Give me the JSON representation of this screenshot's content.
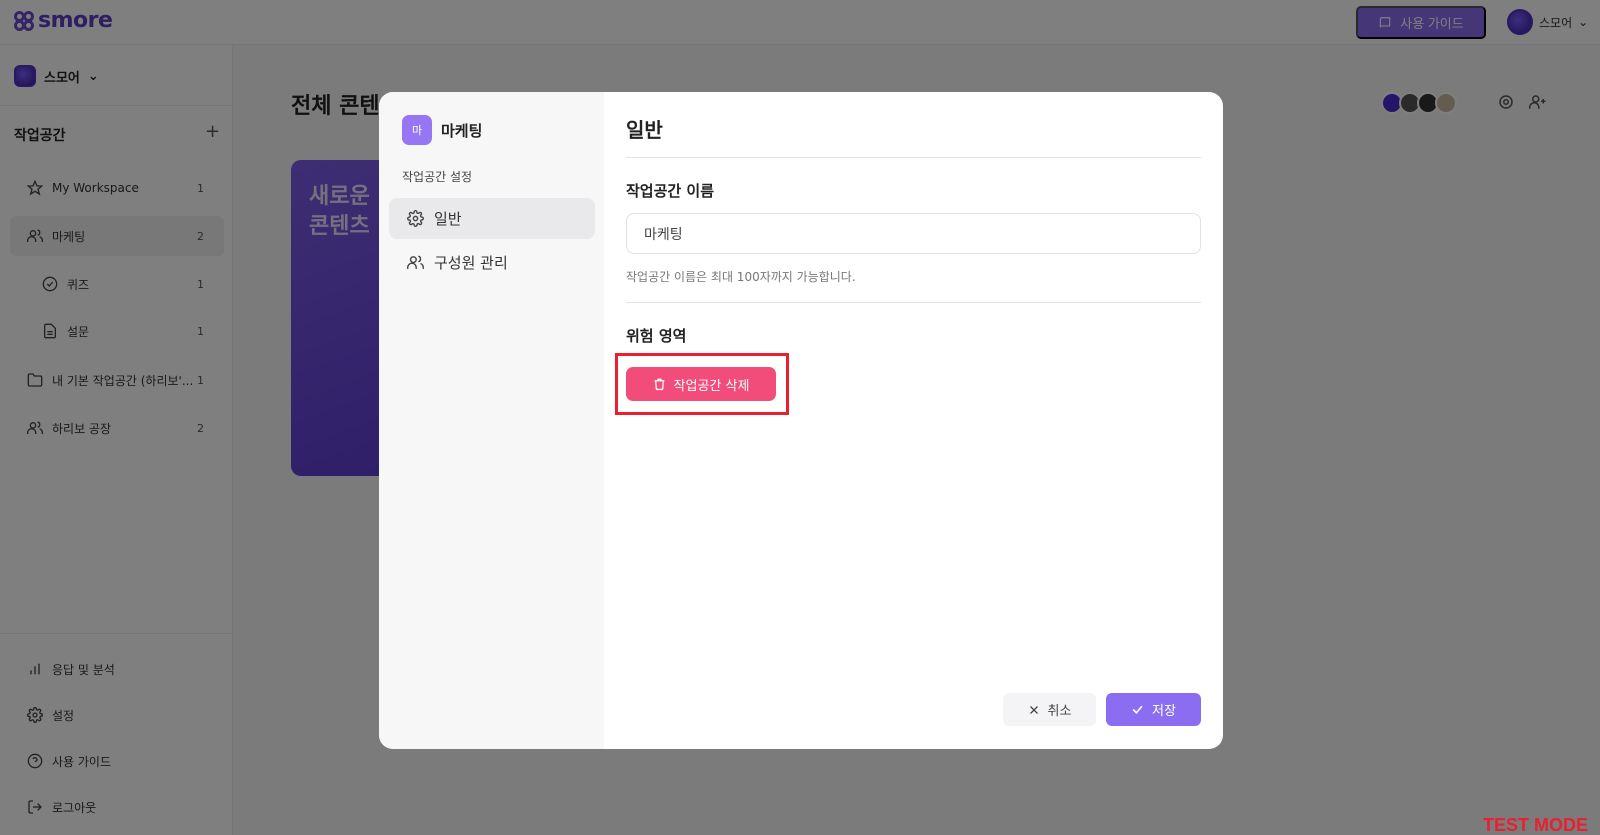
{
  "app": {
    "logo_text": "smore",
    "guide_button": "사용 가이드",
    "user_name": "스모어"
  },
  "sidebar": {
    "workspace_name": "스모어",
    "section_title": "작업공간",
    "items": [
      {
        "label": "My Workspace",
        "count": "1"
      },
      {
        "label": "마케팅",
        "count": "2"
      },
      {
        "label": "퀴즈",
        "count": "1"
      },
      {
        "label": "설문",
        "count": "1"
      },
      {
        "label": "내 기본 작업공간 (하리보'...",
        "count": "1"
      },
      {
        "label": "하리보 공장",
        "count": "2"
      }
    ],
    "bottom_items": [
      {
        "label": "응답 및 분석"
      },
      {
        "label": "설정"
      },
      {
        "label": "사용 가이드"
      },
      {
        "label": "로그아웃"
      }
    ]
  },
  "main": {
    "title": "전체 콘텐",
    "card_text_1": "새로운",
    "card_text_2": "콘텐츠"
  },
  "modal": {
    "ws_badge": "마",
    "ws_name": "마케팅",
    "side_label": "작업공간 설정",
    "menu": [
      {
        "label": "일반"
      },
      {
        "label": "구성원 관리"
      }
    ],
    "section_title": "일반",
    "name_label": "작업공간 이름",
    "name_value": "마케팅",
    "helper": "작업공간 이름은 최대 100자까지 가능합니다.",
    "danger_title": "위험 영역",
    "delete_button": "작업공간 삭제",
    "cancel_button": "취소",
    "save_button": "저장"
  },
  "watermark": "TEST MODE",
  "colors": {
    "brand": "#8a6df0",
    "danger": "#f24d7a",
    "highlight": "#e8202f"
  }
}
